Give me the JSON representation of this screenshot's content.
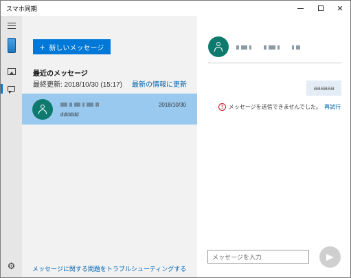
{
  "app": {
    "title": "スマホ同期"
  },
  "window_controls": {
    "minimize": "minimize-icon",
    "maximize": "maximize-icon",
    "close": "close-icon",
    "close_glyph": "✕"
  },
  "nav": {
    "items": [
      {
        "icon": "hamburger-menu-icon"
      },
      {
        "icon": "phone-icon"
      },
      {
        "icon": "photos-icon"
      },
      {
        "icon": "messages-icon",
        "selected": true
      },
      {
        "icon": "gear-icon"
      }
    ],
    "settings_glyph": "⚙"
  },
  "list": {
    "new_message_label": "新しいメッセージ",
    "new_message_plus": "+",
    "recent_title": "最近のメッセージ",
    "last_updated": "最終更新: 2018/10/30 (15:17)",
    "refresh_link": "最新の情報に更新",
    "conversations": [
      {
        "preview": "dddddd",
        "date": "2018/10/30",
        "selected": true
      }
    ],
    "troubleshoot_link": "メッセージに関する問題をトラブルシューティングする"
  },
  "chat": {
    "messages": [
      {
        "text": "aaaaaa",
        "outgoing": true
      }
    ],
    "error_icon_glyph": "!",
    "error_text": "メッセージを送信できませんでした。",
    "retry_label": "再試行",
    "input_placeholder": "メッセージを入力"
  },
  "colors": {
    "accent": "#0078d7",
    "selected_row": "#99c9ef",
    "avatar": "#0e7a6e",
    "rail_bg": "#e6e6e6",
    "list_bg": "#f2f2f2",
    "error": "#c50f1f"
  }
}
